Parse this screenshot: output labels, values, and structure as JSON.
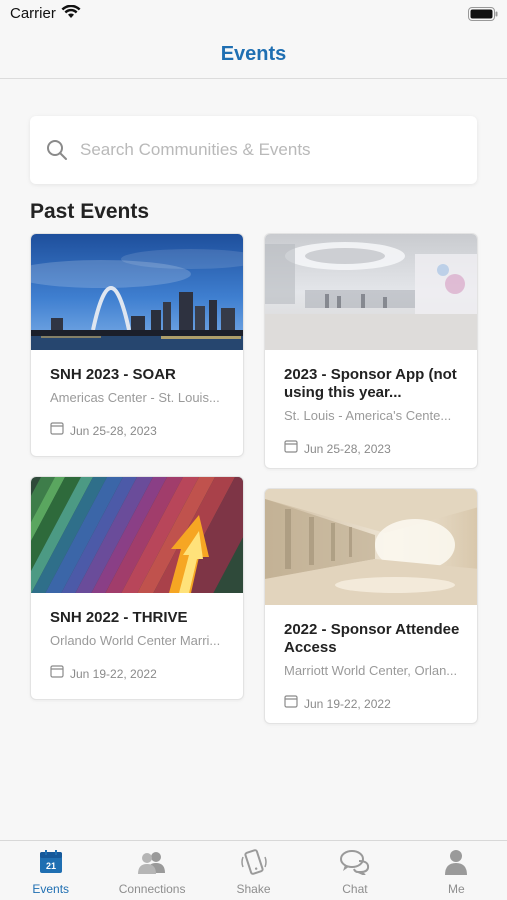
{
  "status_bar": {
    "carrier": "Carrier"
  },
  "header": {
    "title": "Events"
  },
  "search": {
    "placeholder": "Search Communities & Events"
  },
  "section": {
    "title": "Past Events"
  },
  "events": [
    {
      "title": "SNH 2023 - SOAR",
      "venue": "Americas Center - St. Louis...",
      "date": "Jun 25-28, 2023"
    },
    {
      "title": "2023 - Sponsor App (not using this year...",
      "venue": "St. Louis - America's Cente...",
      "date": "Jun 25-28, 2023"
    },
    {
      "title": "SNH 2022 - THRIVE",
      "venue": "Orlando World Center Marri...",
      "date": "Jun 19-22, 2022"
    },
    {
      "title": "2022 - Sponsor Attendee Access",
      "venue": "Marriott World Center, Orlan...",
      "date": "Jun 19-22, 2022"
    }
  ],
  "tabs": [
    {
      "label": "Events",
      "icon": "calendar-icon",
      "badge": "21",
      "active": true
    },
    {
      "label": "Connections",
      "icon": "people-icon",
      "active": false
    },
    {
      "label": "Shake",
      "icon": "phone-shake-icon",
      "active": false
    },
    {
      "label": "Chat",
      "icon": "chat-bubbles-icon",
      "active": false
    },
    {
      "label": "Me",
      "icon": "person-icon",
      "active": false
    }
  ],
  "colors": {
    "accent": "#1f6fb2",
    "background": "#f7f7f7",
    "inactive": "#8e8e8e"
  }
}
